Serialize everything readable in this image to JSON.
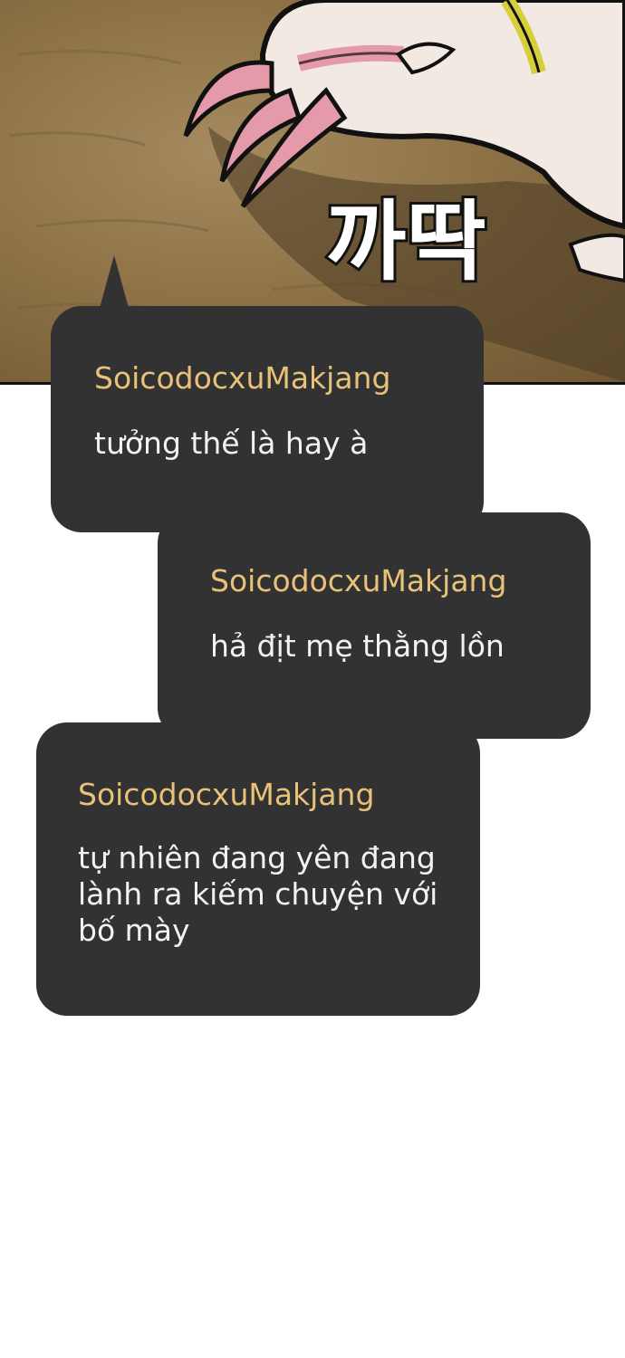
{
  "panel": {
    "sfx_text": "까딱"
  },
  "comments": [
    {
      "user": "SoicodocxuMakjang",
      "text": "tưởng thế là hay à"
    },
    {
      "user": "SoicodocxuMakjang",
      "text": "hả địt mẹ thằng lồn"
    },
    {
      "user": "SoicodocxuMakjang",
      "text": "tự nhiên đang yên đang lành ra kiếm chuyện với bố mày"
    }
  ],
  "colors": {
    "bubble": "#323232",
    "username": "#e9c27a",
    "message": "#f2f2f2",
    "panel_ground": "#8e7347"
  }
}
